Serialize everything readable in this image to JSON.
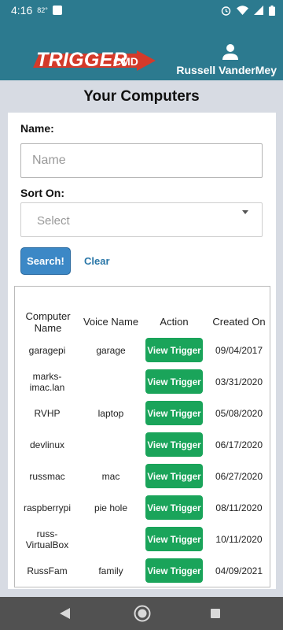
{
  "status_bar": {
    "time": "4:16",
    "temp": "82°"
  },
  "header": {
    "logo_main": "TRIGGER",
    "logo_sub": "CMD",
    "user_name": "Russell VanderMey"
  },
  "page_title": "Your Computers",
  "form": {
    "name_label": "Name:",
    "name_placeholder": "Name",
    "sort_label": "Sort On:",
    "sort_placeholder": "Select",
    "search_label": "Search!",
    "clear_label": "Clear"
  },
  "table": {
    "headers": [
      "Computer Name",
      "Voice Name",
      "Action",
      "Created On"
    ],
    "action_label": "View Trigger",
    "rows": [
      {
        "computer": "garagepi",
        "voice": "garage",
        "created": "09/04/2017"
      },
      {
        "computer": "marks-imac.lan",
        "voice": "",
        "created": "03/31/2020"
      },
      {
        "computer": "RVHP",
        "voice": "laptop",
        "created": "05/08/2020"
      },
      {
        "computer": "devlinux",
        "voice": "",
        "created": "06/17/2020"
      },
      {
        "computer": "russmac",
        "voice": "mac",
        "created": "06/27/2020"
      },
      {
        "computer": "raspberrypi",
        "voice": "pie hole",
        "created": "08/11/2020"
      },
      {
        "computer": "russ-VirtualBox",
        "voice": "",
        "created": "10/11/2020"
      },
      {
        "computer": "RussFam",
        "voice": "family",
        "created": "04/09/2021"
      }
    ]
  },
  "colors": {
    "header": "#2c7a8f",
    "search_button": "#3c88c6",
    "view_button": "#1aa45a",
    "nav_bar": "#515151"
  }
}
